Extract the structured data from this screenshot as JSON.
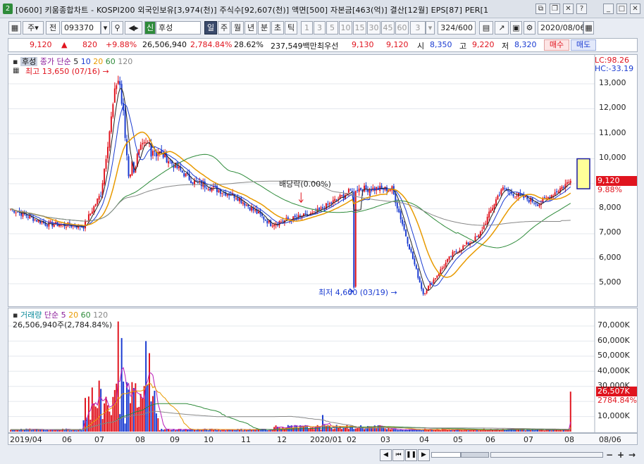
{
  "window": {
    "number": "2",
    "title": "[0600] 키움종합차트 - KOSPI200 외국인보유[3,974(천)] 주식수[92,607(천)] 액면[500] 자본금[463(억)] 결산[12월] EPS[87] PER[1"
  },
  "toolbar": {
    "market": "주",
    "whole": "전",
    "code": "093370",
    "new_badge": "신",
    "stock_name": "후성",
    "periods": [
      "일",
      "주",
      "월",
      "년",
      "분",
      "초",
      "틱"
    ],
    "intervals": [
      "1",
      "3",
      "5",
      "10",
      "15",
      "30",
      "45",
      "60"
    ],
    "interval_select": "3",
    "count": "324",
    "count_max": "/600",
    "date": "2020/08/06"
  },
  "quote": {
    "price": "9,120",
    "arrow": "▲",
    "change": "820",
    "change_pct": "+9.88%",
    "volume": "26,506,940",
    "volume_ratio": "2,784.84%",
    "turnover": "28.62%",
    "amount": "237,549백만",
    "best_label": "최우선",
    "ask": "9,130",
    "bid": "9,120",
    "open_label": "시",
    "open": "8,350",
    "high_label": "고",
    "high": "9,220",
    "low_label": "저",
    "low": "8,320",
    "buy_label": "매수",
    "sell_label": "매도"
  },
  "price_panel": {
    "name": "후성",
    "legend_prefix": "종가 단순",
    "ma_labels": [
      "5",
      "10",
      "20",
      "60",
      "120"
    ],
    "high_marker": "최고 13,650 (07/16)",
    "low_marker": "최저 4,600 (03/19)",
    "dividend": "배당락(0.00%)",
    "lc": "LC:98.26",
    "hc": "HC:-33.19",
    "last_price": "9,120",
    "last_pct": "9.88%",
    "y_ticks": [
      "13,000",
      "12,000",
      "11,000",
      "10,000",
      "9,000",
      "8,000",
      "7,000",
      "6,000",
      "5,000"
    ]
  },
  "volume_panel": {
    "legend_name": "거래량",
    "legend_prefix": "단순",
    "ma_labels": [
      "5",
      "20",
      "60",
      "120"
    ],
    "current": "26,506,940주(2,784.84%)",
    "last_volume": "26,507K",
    "last_pct": "2784.84%",
    "y_ticks": [
      "70,000K",
      "60,000K",
      "50,000K",
      "40,000K",
      "30,000K",
      "20,000K",
      "10,000K"
    ]
  },
  "x_axis": {
    "ticks": [
      "2019/04",
      "06",
      "07",
      "08",
      "09",
      "10",
      "11",
      "12",
      "2020/01",
      "02",
      "03",
      "04",
      "05",
      "06",
      "07",
      "08"
    ],
    "right_label": "08/06"
  },
  "colors": {
    "up": "#e0141e",
    "down": "#1a3bd1",
    "ma5": "#222222",
    "ma10": "#1a3bd1",
    "ma20": "#e89a00",
    "ma60": "#2e8b3a",
    "ma120": "#888888"
  },
  "chart_data": {
    "type": "candlestick",
    "x_range": [
      "2019/04",
      "2020/08/06"
    ],
    "ylim": [
      4500,
      13700
    ],
    "checkpoints": [
      {
        "date": "2019/04",
        "close": 8000
      },
      {
        "date": "2019/05",
        "close": 7400
      },
      {
        "date": "2019/06",
        "close": 7300
      },
      {
        "date": "2019/07 early",
        "close": 8600
      },
      {
        "date": "2019/07/16",
        "close": 13650
      },
      {
        "date": "2019/07 late",
        "close": 9500
      },
      {
        "date": "2019/08",
        "close": 10600
      },
      {
        "date": "2019/09",
        "close": 9100
      },
      {
        "date": "2019/10",
        "close": 8500
      },
      {
        "date": "2019/11",
        "close": 7400
      },
      {
        "date": "2019/12",
        "close": 7800
      },
      {
        "date": "2020/01",
        "close": 8800
      },
      {
        "date": "2020/02",
        "close": 8800
      },
      {
        "date": "2020/03/19",
        "close": 4600
      },
      {
        "date": "2020/04",
        "close": 6200
      },
      {
        "date": "2020/05",
        "close": 6900
      },
      {
        "date": "2020/06",
        "close": 8800
      },
      {
        "date": "2020/07",
        "close": 8200
      },
      {
        "date": "2020/08/06",
        "close": 9120
      }
    ],
    "volume_peaks_k": [
      {
        "date": "2019/07",
        "volume": 73000
      },
      {
        "date": "2019/08",
        "volume": 60000
      },
      {
        "date": "2020/08/06",
        "volume": 26507
      }
    ]
  }
}
